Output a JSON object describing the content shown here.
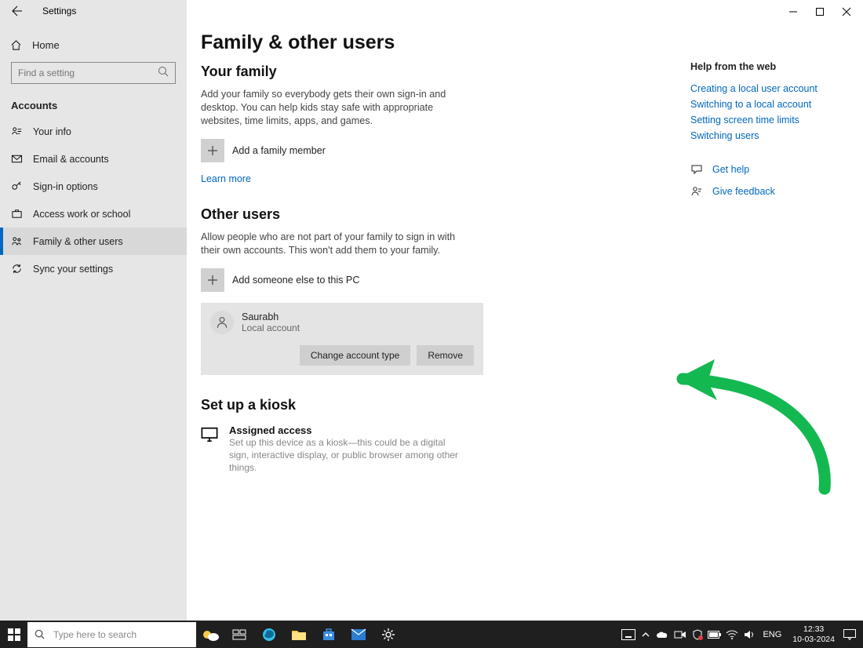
{
  "window": {
    "back_label": "Settings"
  },
  "home": {
    "label": "Home"
  },
  "search": {
    "placeholder": "Find a setting"
  },
  "section_label": "Accounts",
  "nav": [
    {
      "label": "Your info"
    },
    {
      "label": "Email & accounts"
    },
    {
      "label": "Sign-in options"
    },
    {
      "label": "Access work or school"
    },
    {
      "label": "Family & other users"
    },
    {
      "label": "Sync your settings"
    }
  ],
  "page": {
    "title": "Family & other users",
    "family": {
      "heading": "Your family",
      "desc": "Add your family so everybody gets their own sign-in and desktop. You can help kids stay safe with appropriate websites, time limits, apps, and games.",
      "add_label": "Add a family member",
      "learn_more": "Learn more"
    },
    "other": {
      "heading": "Other users",
      "desc": "Allow people who are not part of your family to sign in with their own accounts. This won't add them to your family.",
      "add_label": "Add someone else to this PC",
      "user": {
        "name": "Saurabh",
        "type": "Local account",
        "change_btn": "Change account type",
        "remove_btn": "Remove"
      }
    },
    "kiosk": {
      "heading": "Set up a kiosk",
      "title": "Assigned access",
      "desc": "Set up this device as a kiosk—this could be a digital sign, interactive display, or public browser among other things."
    }
  },
  "help": {
    "header": "Help from the web",
    "links": [
      "Creating a local user account",
      "Switching to a local account",
      "Setting screen time limits",
      "Switching users"
    ],
    "get_help": "Get help",
    "feedback": "Give feedback"
  },
  "taskbar": {
    "search_placeholder": "Type here to search",
    "lang": "ENG",
    "time": "12:33",
    "date": "10-03-2024"
  }
}
